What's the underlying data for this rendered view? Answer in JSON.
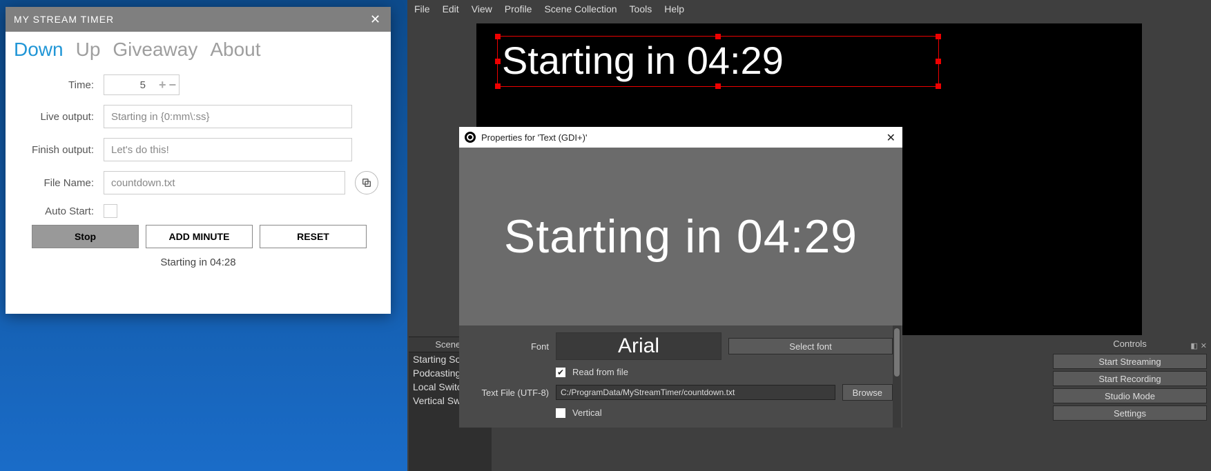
{
  "timer": {
    "title": "MY STREAM TIMER",
    "tabs": [
      "Down",
      "Up",
      "Giveaway",
      "About"
    ],
    "active_tab": 0,
    "labels": {
      "time": "Time:",
      "live_output": "Live output:",
      "finish_output": "Finish output:",
      "file_name": "File Name:",
      "auto_start": "Auto Start:"
    },
    "values": {
      "time": "5",
      "live_output": "Starting in {0:mm\\:ss}",
      "finish_output": "Let's do this!",
      "file_name": "countdown.txt"
    },
    "buttons": {
      "stop": "Stop",
      "add_minute": "ADD MINUTE",
      "reset": "RESET"
    },
    "status": "Starting in 04:28"
  },
  "obs": {
    "menu": [
      "File",
      "Edit",
      "View",
      "Profile",
      "Scene Collection",
      "Tools",
      "Help"
    ],
    "preview_text": "Starting in 04:29",
    "properties": {
      "title": "Properties for 'Text (GDI+)'",
      "preview_text": "Starting in 04:29",
      "font_label": "Font",
      "font_value": "Arial",
      "select_font": "Select font",
      "read_from_file": "Read from file",
      "text_file_label": "Text File (UTF-8)",
      "text_file_value": "C:/ProgramData/MyStreamTimer/countdown.txt",
      "browse": "Browse",
      "vertical": "Vertical"
    },
    "scenes": {
      "title": "Scenes",
      "items": [
        "Starting Soo",
        "Podcasting",
        "Local Switch",
        "Vertical Swit"
      ]
    },
    "controls": {
      "title": "Controls",
      "buttons": [
        "Start Streaming",
        "Start Recording",
        "Studio Mode",
        "Settings"
      ]
    }
  }
}
